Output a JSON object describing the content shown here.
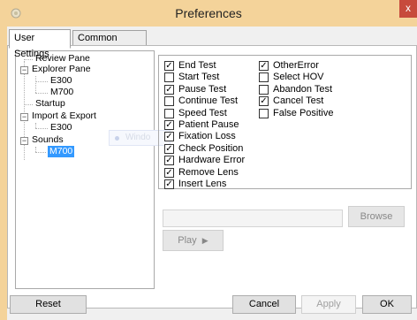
{
  "window": {
    "title": "Preferences",
    "close_glyph": "x"
  },
  "tabs": [
    {
      "label": "User Settings",
      "active": true
    },
    {
      "label": "Common Settings",
      "active": false
    }
  ],
  "tree": {
    "review_pane": "Review Pane",
    "explorer_pane": "Explorer Pane",
    "explorer_e300": "E300",
    "explorer_m700": "M700",
    "startup": "Startup",
    "import_export": "Import & Export",
    "import_e300": "E300",
    "sounds": "Sounds",
    "sounds_m700": "M700",
    "expander_glyph": "−"
  },
  "options_left": [
    {
      "label": "End Test",
      "checked": true
    },
    {
      "label": "Start Test",
      "checked": false
    },
    {
      "label": "Pause Test",
      "checked": true
    },
    {
      "label": "Continue Test",
      "checked": false
    },
    {
      "label": "Speed Test",
      "checked": false
    },
    {
      "label": "Patient Pause",
      "checked": true
    },
    {
      "label": "Fixation Loss",
      "checked": true
    },
    {
      "label": "Check Position",
      "checked": true
    },
    {
      "label": "Hardware Error",
      "checked": true
    },
    {
      "label": "Remove Lens",
      "checked": true
    },
    {
      "label": "Insert Lens",
      "checked": true
    }
  ],
  "options_right": [
    {
      "label": "OtherError",
      "checked": true
    },
    {
      "label": "Select HOV",
      "checked": false
    },
    {
      "label": "Abandon Test",
      "checked": false
    },
    {
      "label": "Cancel Test",
      "checked": true
    },
    {
      "label": "False Positive",
      "checked": false
    }
  ],
  "sound": {
    "browse_label": "Browse",
    "play_label": "Play",
    "play_glyph": "▶"
  },
  "ghost_text": "Windo",
  "footer": {
    "reset_label": "Reset",
    "cancel_label": "Cancel",
    "apply_label": "Apply",
    "ok_label": "OK"
  },
  "colors": {
    "titlebar": "#f4d39a",
    "selection": "#3399ff",
    "close": "#c74a3c"
  },
  "icons": {
    "app": "settings-gear-icon",
    "close": "close-icon",
    "play": "play-triangle-icon"
  }
}
